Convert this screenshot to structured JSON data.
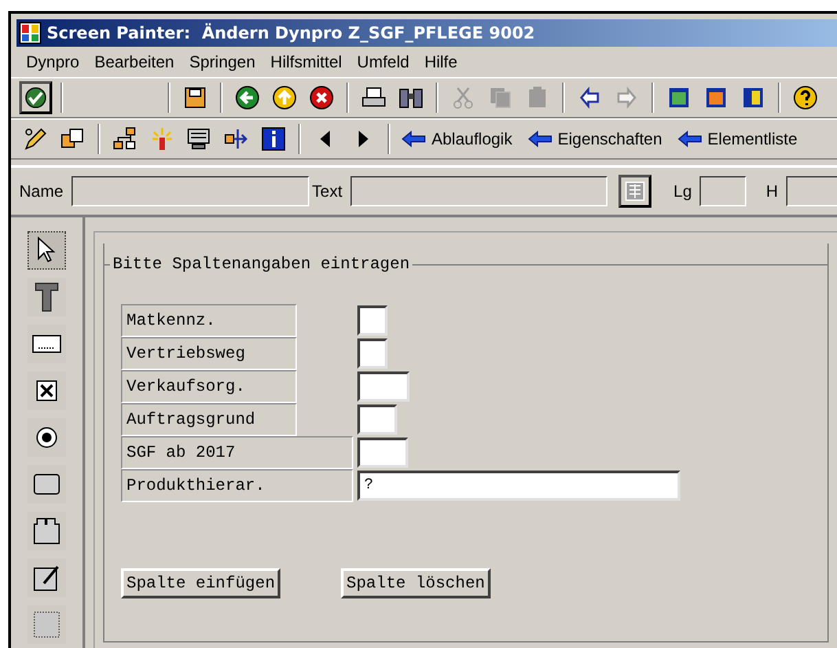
{
  "window": {
    "title": "Screen Painter:  Ändern Dynpro Z_SGF_PFLEGE 9002"
  },
  "menu": [
    "Dynpro",
    "Bearbeiten",
    "Springen",
    "Hilfsmittel",
    "Umfeld",
    "Hilfe"
  ],
  "toolbar": [
    {
      "kind": "enter"
    },
    {
      "kind": "save"
    },
    {
      "kind": "back"
    },
    {
      "kind": "exit"
    },
    {
      "kind": "cancel"
    },
    {
      "kind": "print"
    },
    {
      "kind": "find"
    },
    {
      "kind": "cut",
      "disabled": true
    },
    {
      "kind": "copy",
      "disabled": true
    },
    {
      "kind": "paste",
      "disabled": true
    },
    {
      "kind": "undo"
    },
    {
      "kind": "redo",
      "disabled": true
    },
    {
      "kind": "layout-a"
    },
    {
      "kind": "layout-b"
    },
    {
      "kind": "layout-c"
    },
    {
      "kind": "help"
    }
  ],
  "app_toolbar": {
    "nav_buttons": [
      "Ablauflogik",
      "Eigenschaften",
      "Elementliste"
    ]
  },
  "attributes": {
    "name_label": "Name",
    "text_label": "Text",
    "length_label": "Lg",
    "height_label": "H"
  },
  "palette": [
    {
      "kind": "pointer",
      "selected": true
    },
    {
      "kind": "text",
      "selected": false
    },
    {
      "kind": "input",
      "selected": false
    },
    {
      "kind": "checkbox",
      "selected": false
    },
    {
      "kind": "radio",
      "selected": false
    },
    {
      "kind": "pushbutton",
      "selected": false
    },
    {
      "kind": "tabstrip",
      "selected": false
    },
    {
      "kind": "wizard",
      "selected": false
    },
    {
      "kind": "box",
      "selected": false
    }
  ],
  "group_box": {
    "title": "Bitte Spaltenangaben eintragen",
    "rows": [
      {
        "label": "Matkennz.",
        "value": ""
      },
      {
        "label": "Vertriebsweg",
        "value": ""
      },
      {
        "label": "Verkaufsorg.",
        "value": ""
      },
      {
        "label": "Auftragsgrund",
        "value": ""
      },
      {
        "label": "SGF ab 2017",
        "value": ""
      },
      {
        "label": "Produkthierar.",
        "value": "?"
      }
    ],
    "buttons": [
      "Spalte einfügen",
      "Spalte löschen"
    ]
  }
}
